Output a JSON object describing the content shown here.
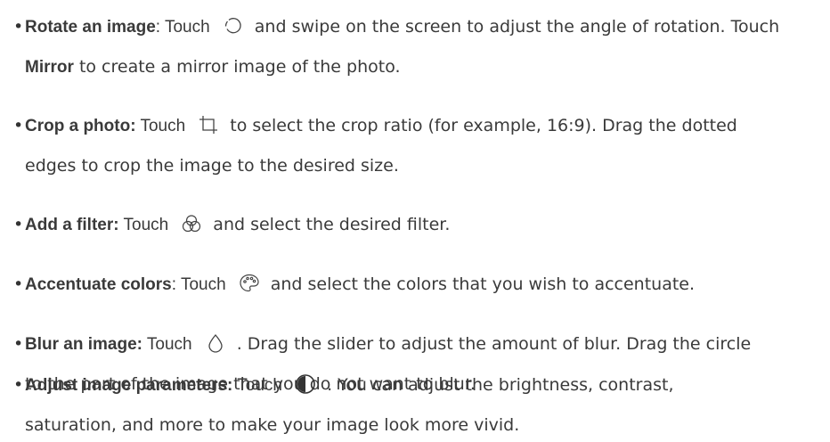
{
  "items": [
    {
      "term": "Rotate an image",
      "after_term": ": Touch",
      "icon": "rotate-icon",
      "rest_line1": "and swipe on the screen to adjust the angle of rotation. Touch",
      "strong2": "Mirror",
      "rest_line2": " to create a mirror image of the photo."
    },
    {
      "term": "Crop a photo:",
      "after_term": " Touch",
      "icon": "crop-icon",
      "rest_line1": "to select the crop ratio (for example, 16:9). Drag the dotted",
      "rest_line2": "edges to crop the image to the desired size."
    },
    {
      "term": "Add a filter:",
      "after_term": " Touch",
      "icon": "filter-icon",
      "rest_line1": "and select the desired filter."
    },
    {
      "term": "Accentuate colors",
      "after_term": ": Touch",
      "icon": "palette-icon",
      "rest_line1": "and select the colors that you wish to accentuate."
    },
    {
      "term": "Blur an image:",
      "after_term": " Touch",
      "icon": "droplet-icon",
      "rest_line1": ". Drag the slider to adjust the amount of blur. Drag the circle",
      "rest_line2": "to the part of the image that you do not want to blur."
    },
    {
      "term": "Adjust image parameters:",
      "after_term": " Touch",
      "icon": "contrast-icon",
      "rest_line1": ". You can adjust the brightness, contrast,",
      "rest_line2": "saturation, and more to make your image look more vivid."
    }
  ]
}
